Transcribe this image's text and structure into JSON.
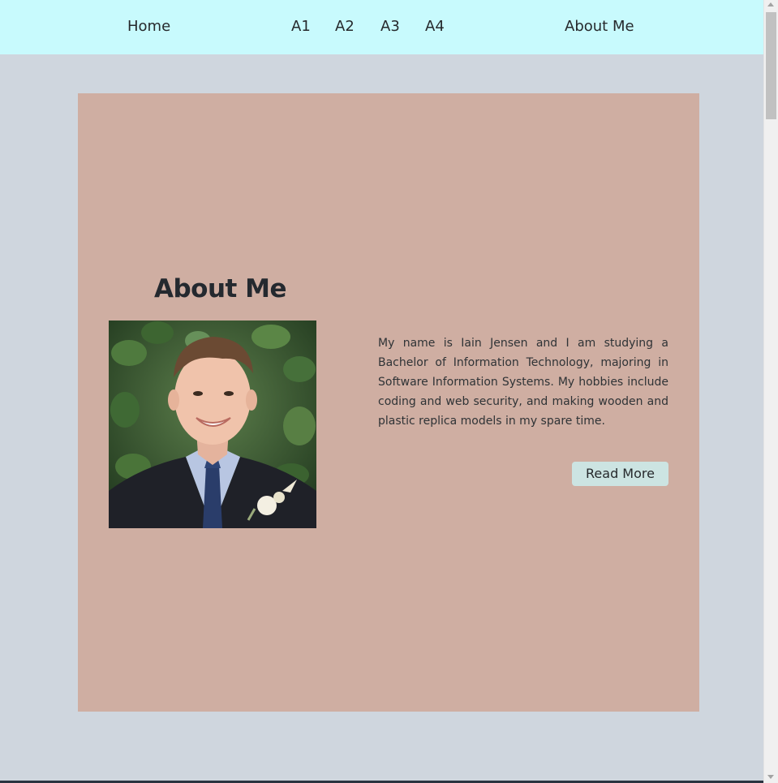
{
  "nav": {
    "home": "Home",
    "a1": "A1",
    "a2": "A2",
    "a3": "A3",
    "a4": "A4",
    "about": "About Me"
  },
  "main": {
    "title": "About Me",
    "photo_subject": "portrait-photo",
    "bio": "My name is Iain Jensen and I am studying a Bachelor of Information Technology, majoring in Software Information Systems. My hobbies include coding and web security, and making wooden and plastic replica models in my spare time.",
    "read_more_label": "Read More"
  },
  "colors": {
    "nav_background": "#c8fafd",
    "page_background": "#cfd6de",
    "card_background": "#cfaea2",
    "button_background": "#cce4e2",
    "text": "#26292c"
  }
}
